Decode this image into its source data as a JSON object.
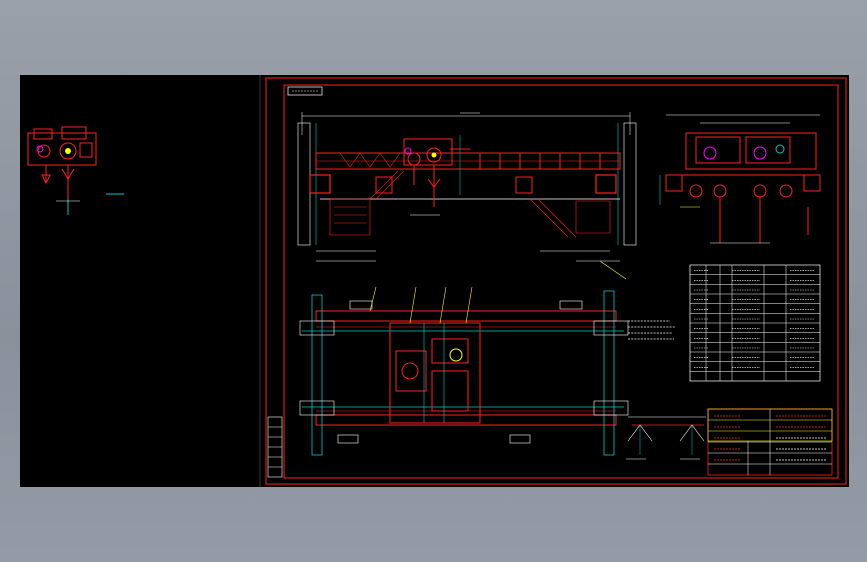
{
  "drawing": {
    "title_tag": "",
    "colors": {
      "background": "#000000",
      "frame": "#ff2020",
      "structure": "#ff2020",
      "beam": "#ff3030",
      "dimension": "#ffffff",
      "axis": "#00c8c8",
      "leader": "#ffff00",
      "detail": "#00ff40",
      "highlight": "#ff00ff"
    }
  },
  "views": {
    "left_thumbnail": "trolley-side-view",
    "front_elevation": "crane-front-elevation",
    "side_elevation": "crane-side-elevation",
    "plan_view": "crane-plan-view",
    "detail_view": "rail-detail-view"
  },
  "parts_table": {
    "rows": 12,
    "cols": 6
  },
  "title_block": {
    "rows": 6
  }
}
